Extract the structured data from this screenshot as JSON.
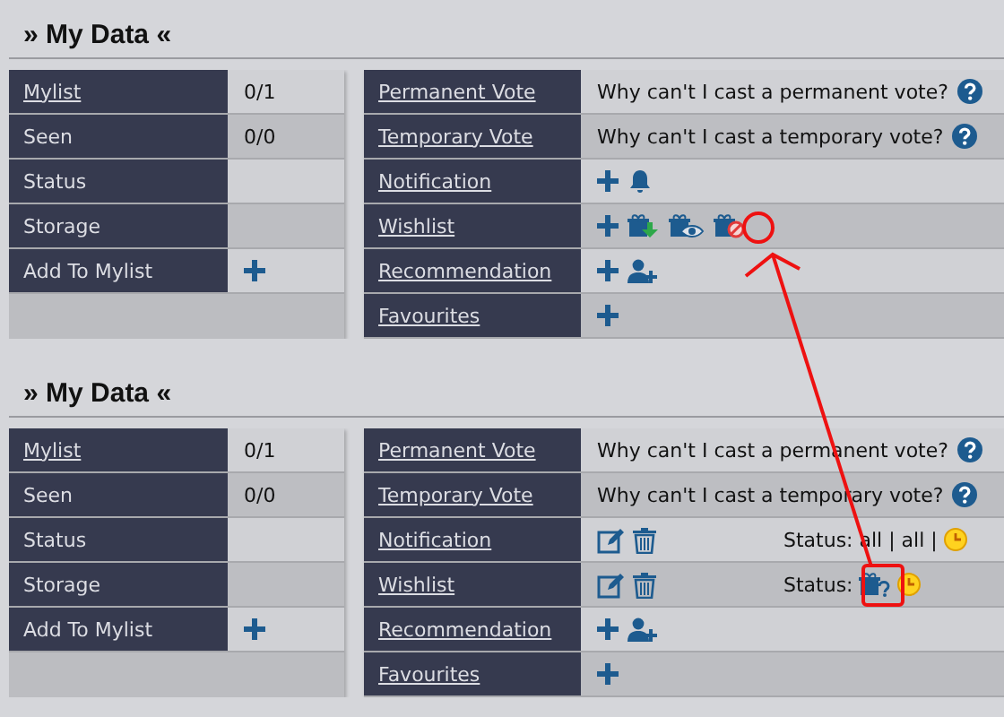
{
  "sections": [
    {
      "title": "» My Data «",
      "left_rows": [
        {
          "label": "Mylist",
          "link": true,
          "value": "0/1"
        },
        {
          "label": "Seen",
          "link": false,
          "value": "0/0"
        },
        {
          "label": "Status",
          "link": false
        },
        {
          "label": "Storage",
          "link": false
        },
        {
          "label": "Add To Mylist",
          "link": false,
          "kind": "add"
        }
      ],
      "right_rows": [
        {
          "label": "Permanent Vote",
          "kind": "vote",
          "text": "Why can't I cast a permanent vote?"
        },
        {
          "label": "Temporary Vote",
          "kind": "vote",
          "text": "Why can't I cast a temporary vote?"
        },
        {
          "label": "Notification",
          "kind": "notification-add"
        },
        {
          "label": "Wishlist",
          "kind": "wishlist-add"
        },
        {
          "label": "Recommendation",
          "kind": "recommendation-add"
        },
        {
          "label": "Favourites",
          "kind": "add"
        }
      ]
    },
    {
      "title": "» My Data «",
      "left_rows": [
        {
          "label": "Mylist",
          "link": true,
          "value": "0/1"
        },
        {
          "label": "Seen",
          "link": false,
          "value": "0/0"
        },
        {
          "label": "Status",
          "link": false
        },
        {
          "label": "Storage",
          "link": false
        },
        {
          "label": "Add To Mylist",
          "link": false,
          "kind": "add"
        }
      ],
      "right_rows": [
        {
          "label": "Permanent Vote",
          "kind": "vote",
          "text": "Why can't I cast a permanent vote?"
        },
        {
          "label": "Temporary Vote",
          "kind": "vote",
          "text": "Why can't I cast a temporary vote?"
        },
        {
          "label": "Notification",
          "kind": "notification-edit",
          "status": "Status: all | all |"
        },
        {
          "label": "Wishlist",
          "kind": "wishlist-edit",
          "status": "Status:"
        },
        {
          "label": "Recommendation",
          "kind": "recommendation-add"
        },
        {
          "label": "Favourites",
          "kind": "add"
        }
      ]
    }
  ]
}
